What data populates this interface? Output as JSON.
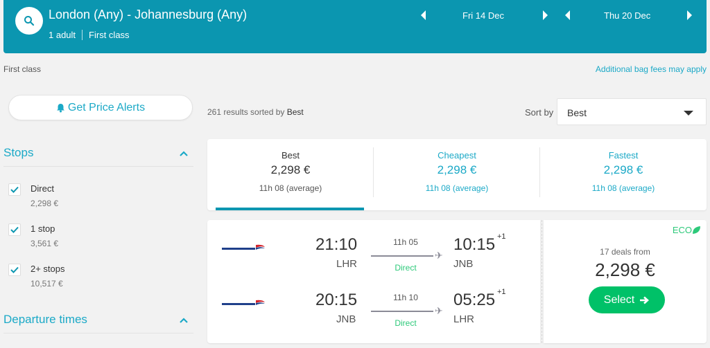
{
  "header": {
    "route": "London (Any) - Johannesburg (Any)",
    "passengers": "1 adult",
    "cabin": "First class",
    "outbound_date": "Fri 14 Dec",
    "return_date": "Thu 20 Dec"
  },
  "subbar": {
    "cabin_label": "First class",
    "bag_fees": "Additional bag fees may apply"
  },
  "sidebar": {
    "price_alerts": "Get Price Alerts",
    "stops_title": "Stops",
    "stops": [
      {
        "label": "Direct",
        "price": "2,298 €",
        "checked": true
      },
      {
        "label": "1 stop",
        "price": "3,561 €",
        "checked": true
      },
      {
        "label": "2+ stops",
        "price": "10,517 €",
        "checked": true
      }
    ],
    "departure_title": "Departure times"
  },
  "results": {
    "count_text": "261 results sorted by",
    "sorted_by": "Best",
    "sort_label": "Sort by",
    "sort_value": "Best"
  },
  "tabs": [
    {
      "name": "Best",
      "price": "2,298 €",
      "duration": "11h 08 (average)"
    },
    {
      "name": "Cheapest",
      "price": "2,298 €",
      "duration": "11h 08 (average)"
    },
    {
      "name": "Fastest",
      "price": "2,298 €",
      "duration": "11h 08 (average)"
    }
  ],
  "card": {
    "legs": [
      {
        "dep_time": "21:10",
        "dep_code": "LHR",
        "duration": "11h 05",
        "type": "Direct",
        "arr_time": "10:15",
        "arr_offset": "+1",
        "arr_code": "JNB"
      },
      {
        "dep_time": "20:15",
        "dep_code": "JNB",
        "duration": "11h 10",
        "type": "Direct",
        "arr_time": "05:25",
        "arr_offset": "+1",
        "arr_code": "LHR"
      }
    ],
    "eco": "ECO",
    "deals": "17 deals from",
    "price": "2,298 €",
    "select": "Select"
  },
  "colors": {
    "brand": "#0b96b0",
    "link": "#1ba9c7",
    "green": "#00c168"
  },
  "icons": {
    "search": "search-icon",
    "bell": "bell-icon",
    "check": "check-icon",
    "chevron": "chevron-up-icon",
    "plane": "plane-icon",
    "leaf": "leaf-icon",
    "arrow": "arrow-right-icon"
  }
}
